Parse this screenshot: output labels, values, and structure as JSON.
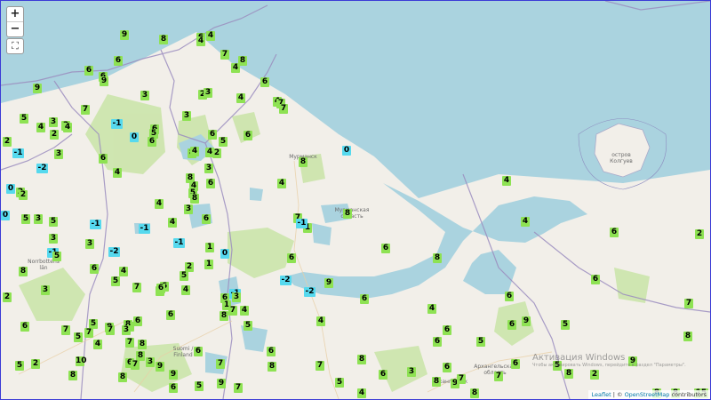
{
  "controls": {
    "zoom_in": "+",
    "zoom_out": "−",
    "fullscreen": "⛶"
  },
  "attribution": {
    "leaflet": "Leaflet",
    "sep": " | © ",
    "osm": "OpenStreetMap",
    "suffix": " contributors"
  },
  "labels": [
    {
      "id": "kolguev",
      "text": "остров\nКолгуев"
    },
    {
      "id": "murmansk",
      "text": "Мурманск"
    },
    {
      "id": "murmansk-oblast",
      "text": "Мурманская\nобласть"
    },
    {
      "id": "norrbotten",
      "text": "Norrbottens\nlän"
    },
    {
      "id": "suomi",
      "text": "Suomi /\nFinland"
    },
    {
      "id": "arkhangelsk",
      "text": "Архангельск"
    },
    {
      "id": "arkh-oblast",
      "text": "Архангельская\nобласть"
    }
  ],
  "watermark": {
    "title": "Активация Windows",
    "subtitle": "Чтобы активировать Windows, перейдите в раздел \"Параметры\"."
  },
  "colors": {
    "positive": "#8ee253",
    "negative": "#56d9ee"
  },
  "markers": [
    9,
    8,
    6,
    4,
    9,
    7,
    6,
    6,
    8,
    4,
    6,
    9,
    2,
    3,
    3,
    4,
    6,
    7,
    4,
    4,
    3,
    7,
    5,
    4,
    3,
    -1,
    3,
    4,
    2,
    6,
    2,
    -1,
    0,
    5,
    6,
    6,
    5,
    6,
    4,
    -2,
    4,
    3,
    6,
    8,
    4,
    2,
    3,
    8,
    4,
    5,
    6,
    8,
    0,
    5,
    1,
    0,
    2,
    2,
    -1,
    -1,
    3,
    5,
    3,
    4,
    4,
    -1,
    6,
    1,
    3,
    3,
    2,
    -1,
    5,
    -2,
    8,
    6,
    4,
    5,
    7,
    6,
    6,
    4,
    2,
    5,
    6,
    3,
    -1,
    0,
    1,
    6,
    6,
    3,
    4,
    5,
    8,
    6,
    5,
    7,
    2,
    8,
    8,
    3,
    6,
    1,
    7,
    6,
    4,
    5,
    7,
    7,
    8,
    4,
    7,
    8,
    6,
    3,
    9,
    7,
    5,
    2,
    10,
    8,
    8,
    6,
    7,
    6,
    9,
    9,
    6,
    7,
    5,
    8,
    7,
    5,
    8,
    4,
    6,
    3,
    8,
    6,
    9,
    7,
    8,
    7,
    6,
    5,
    8,
    2,
    9,
    8,
    7,
    8,
    8,
    2,
    5,
    5,
    6,
    9,
    5,
    4,
    6,
    6,
    6,
    8,
    6,
    9,
    7,
    8,
    4,
    7,
    -1,
    -2,
    -2,
    0,
    4,
    4,
    6,
    2,
    6,
    8,
    6
  ]
}
